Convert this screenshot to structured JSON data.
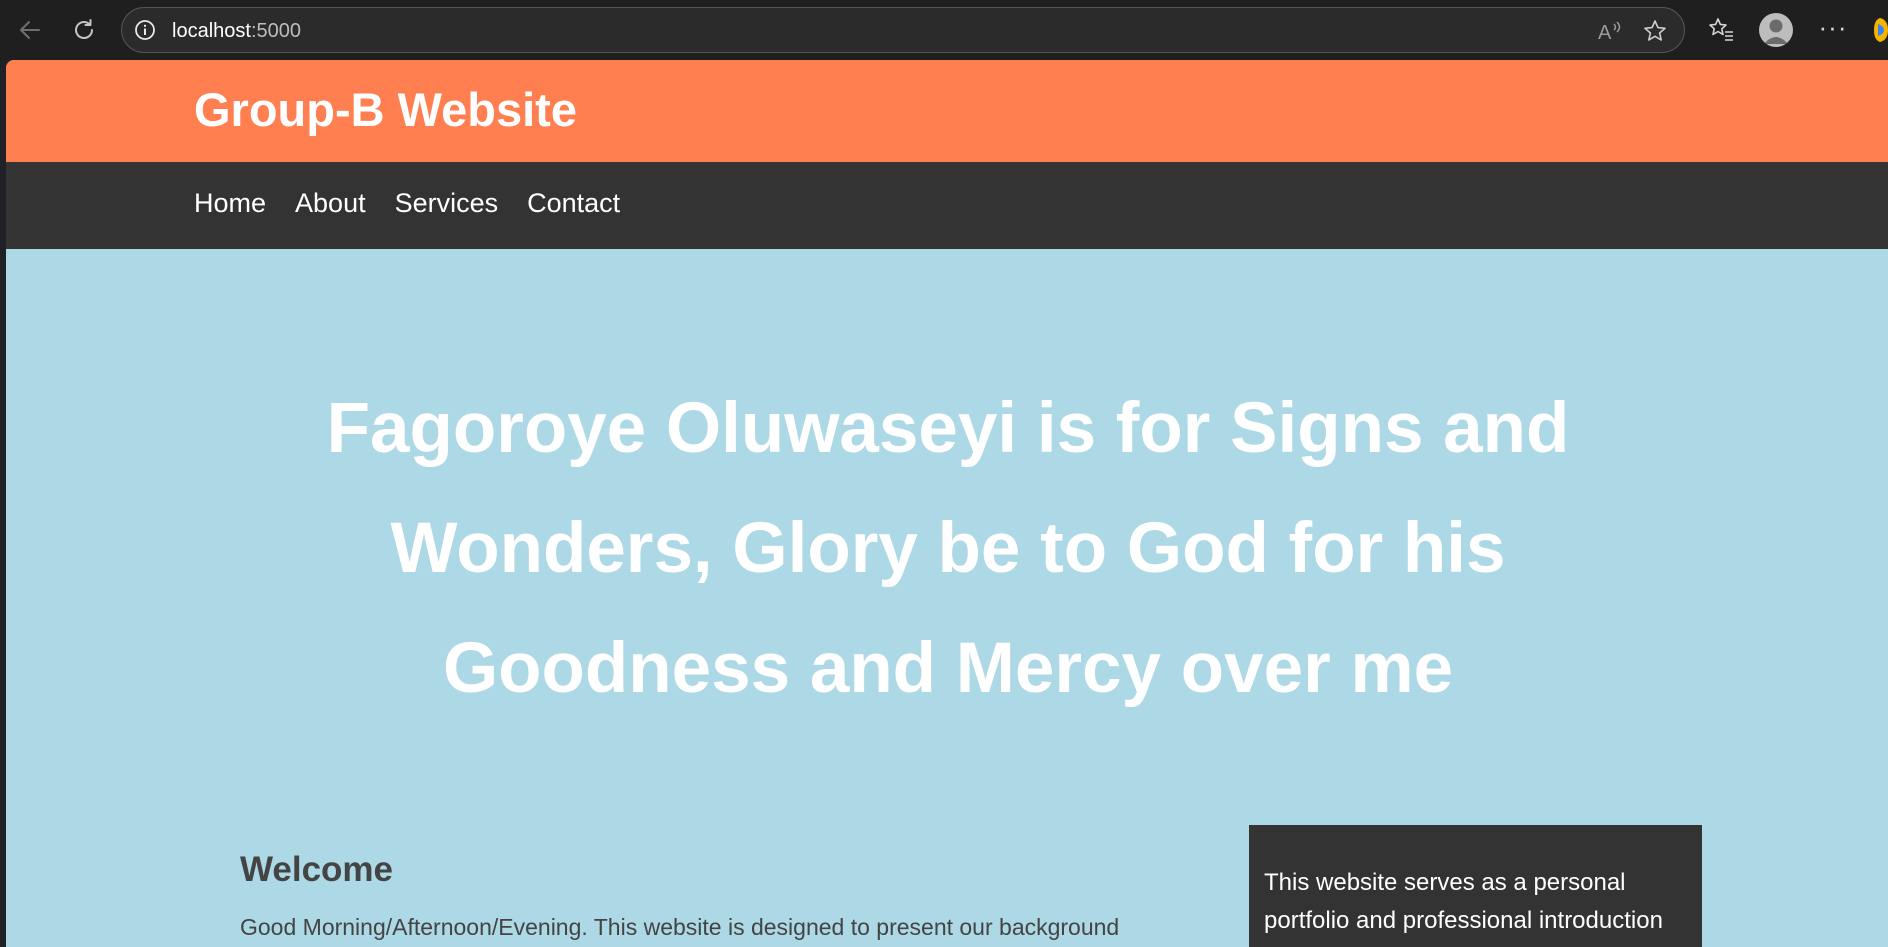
{
  "browser": {
    "url_host": "localhost",
    "url_port": ":5000",
    "colors": {
      "chrome_bg": "#1f1f1f",
      "address_bg": "#2b2b2b"
    },
    "icons": [
      "back-arrow-icon",
      "reload-icon",
      "info-icon",
      "read-aloud-icon",
      "star-icon",
      "favorites-icon",
      "profile-avatar",
      "more-icon",
      "copilot-icon"
    ]
  },
  "site": {
    "title": "Group-B Website",
    "nav": [
      "Home",
      "About",
      "Services",
      "Contact"
    ],
    "hero_heading": "Fagoroye Oluwaseyi is for Signs and Wonders, Glory be to God for his Goodness and Mercy over me",
    "main": {
      "heading": "Welcome",
      "paragraph": "Good Morning/Afternoon/Evening. This website is designed to present our background"
    },
    "aside": {
      "text": "This website serves as a personal portfolio and professional introduction"
    },
    "colors": {
      "header": "#ff7f50",
      "nav": "#333333",
      "page_bg": "#add8e6",
      "aside_bg": "#333333"
    }
  }
}
